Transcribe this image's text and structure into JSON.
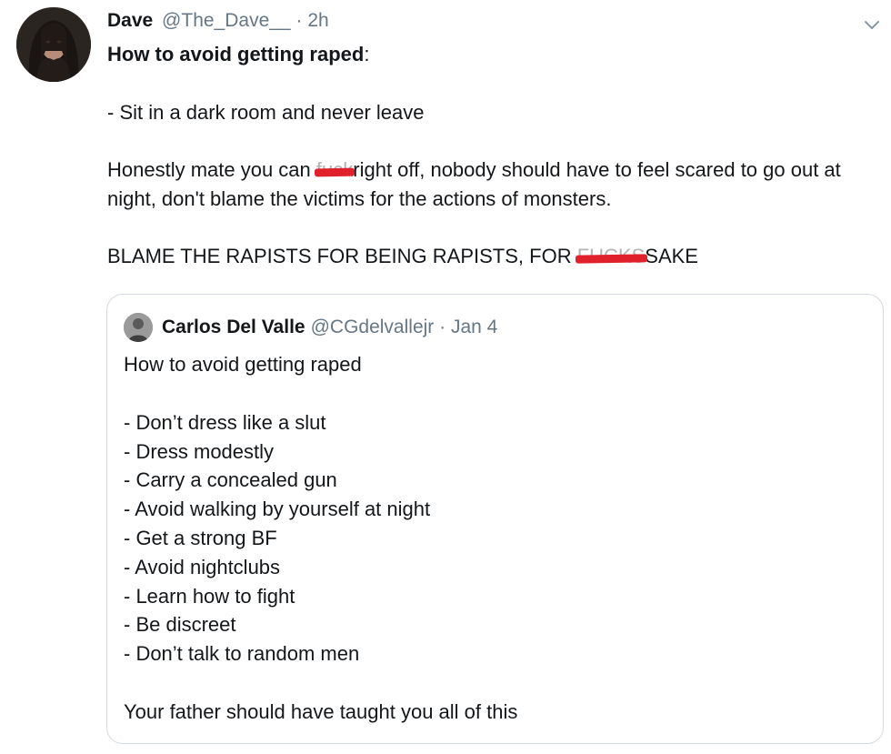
{
  "tweet": {
    "author_name": "Dave",
    "author_handle": "@The_Dave__",
    "separator": "·",
    "time": "2h",
    "avatar_icon": "user-avatar-long-hair",
    "menu_icon": "chevron-down-icon",
    "headline": "How to avoid getting raped",
    "headline_colon": ":",
    "line1": "- Sit in a dark room and never leave",
    "para_prefix": "Honestly mate you can ",
    "censored_1": "fuck",
    "para_suffix": "right off, nobody should have to feel scared to go out at night, don't blame the victims for the actions of monsters.",
    "shout_prefix": "BLAME THE RAPISTS FOR BEING RAPISTS, FOR ",
    "censored_2": "FUCKS",
    "shout_suffix": "SAKE",
    "censor_color": "#e0202a"
  },
  "quoted": {
    "author_name": "Carlos Del Valle",
    "author_handle": "@CGdelvallejr",
    "separator": "·",
    "date": "Jan 4",
    "title": "How to avoid getting raped",
    "items": [
      "- Don’t dress like a slut",
      "- Dress modestly",
      "- Carry a concealed gun",
      "- Avoid walking by yourself at night",
      "- Get a strong BF",
      "- Avoid nightclubs",
      "- Learn how to fight",
      "- Be discreet",
      "- Don’t talk to random men"
    ],
    "closing": "Your father should have taught you all of this"
  },
  "colors": {
    "text": "#14171a",
    "secondary": "#657786",
    "border": "#d5dbe0"
  }
}
